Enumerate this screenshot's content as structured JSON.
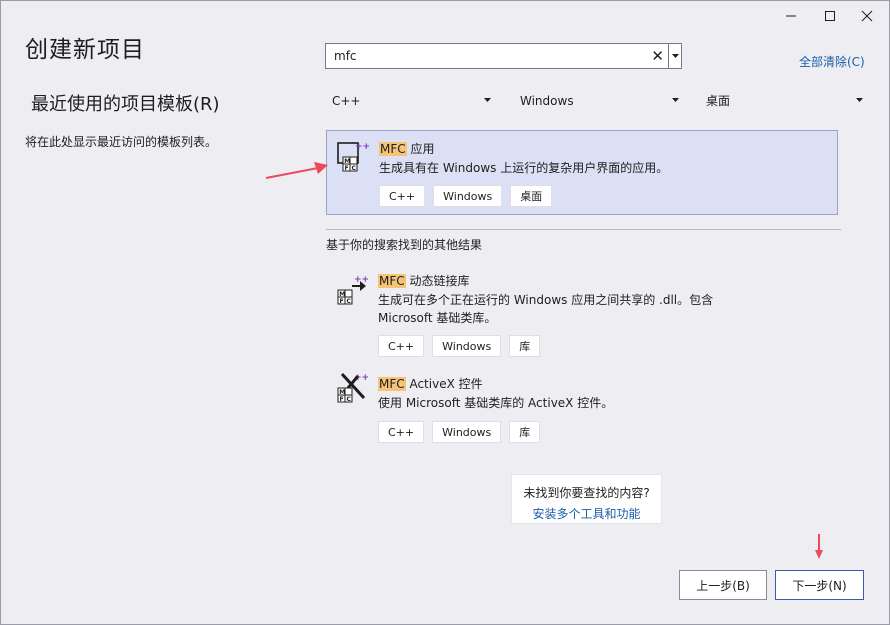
{
  "window": {
    "title": "创建新项目",
    "controls": {
      "minimize": "—",
      "maximize": "☐",
      "close": "✕"
    }
  },
  "recent": {
    "heading": "最近使用的项目模板(R)",
    "empty_text": "将在此处显示最近访问的模板列表。"
  },
  "search": {
    "value": "mfc",
    "clear_icon": "✕",
    "clear_all": "全部清除(C)"
  },
  "filters": {
    "language": "C++",
    "platform": "Windows",
    "project_type": "桌面"
  },
  "results": {
    "top": {
      "highlight": "MFC",
      "name_rest": " 应用",
      "desc": "生成具有在 Windows 上运行的复杂用户界面的应用。",
      "tags": [
        "C++",
        "Windows",
        "桌面"
      ]
    },
    "other_heading": "基于你的搜索找到的其他结果",
    "others": [
      {
        "highlight": "MFC",
        "name_rest": " 动态链接库",
        "desc": "生成可在多个正在运行的 Windows 应用之间共享的 .dll。包含 Microsoft 基础类库。",
        "tags": [
          "C++",
          "Windows",
          "库"
        ]
      },
      {
        "highlight": "MFC",
        "name_rest": " ActiveX 控件",
        "desc": "使用 Microsoft 基础类库的 ActiveX 控件。",
        "tags": [
          "C++",
          "Windows",
          "库"
        ]
      }
    ]
  },
  "notfound": {
    "question": "未找到你要查找的内容?",
    "link": "安装多个工具和功能"
  },
  "buttons": {
    "back": "上一步(B)",
    "next": "下一步(N)"
  },
  "colors": {
    "accent_link": "#1a5dab",
    "selection_bg": "#dbe0f4",
    "highlight": "#f6c477",
    "annotation_arrow": "#ec4a5e"
  }
}
